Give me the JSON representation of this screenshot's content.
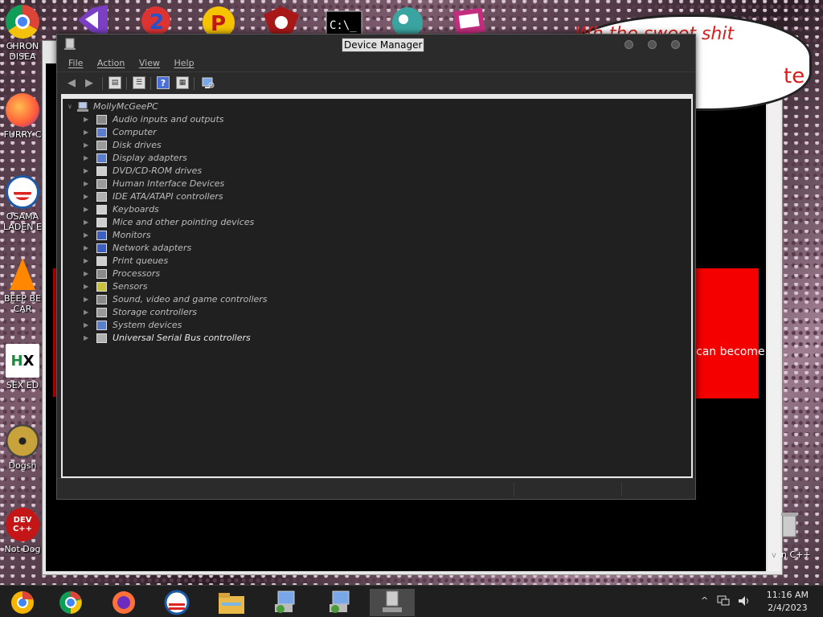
{
  "desktop": {
    "icons": [
      {
        "label_1": "CHRON",
        "label_2": "DISEA",
        "icon": "chrome-icon"
      },
      {
        "label_1": "FURRY C",
        "label_2": "",
        "icon": "firefox-icon"
      },
      {
        "label_1": "OSAMA",
        "label_2": "LADEN E",
        "icon": "obama-logo-icon"
      },
      {
        "label_1": "BEEP BE",
        "label_2": "CAR",
        "icon": "vlc-cone-icon"
      },
      {
        "label_1": "SEX ED",
        "label_2": "",
        "icon": "hx-icon"
      },
      {
        "label_1": "Dogsh",
        "label_2": "",
        "icon": "disc-icon"
      },
      {
        "label_1": "Not Dog",
        "label_2": "",
        "icon": "dev-cpp-icon",
        "glyph": "DEV C++"
      }
    ],
    "top_icons": [
      "visual-studio-icon",
      "blue-2-icon",
      "p-icon",
      "red-emblem-icon",
      "cmd-icon",
      "globe-icon",
      "media-icon"
    ],
    "right_label": "n C++"
  },
  "background_window": {
    "bubble_text": "Wh  the  sweet shit",
    "bubble_text2": "te",
    "red_panel_text": "can become"
  },
  "device_manager": {
    "title": "Device Manager",
    "menu": [
      {
        "label": "File"
      },
      {
        "label": "Action"
      },
      {
        "label": "View"
      },
      {
        "label": "Help"
      }
    ],
    "toolbar": [
      "back-arrow-icon",
      "forward-arrow-icon",
      "show-hide-console-tree-icon",
      "properties-icon",
      "help-icon",
      "view-icon",
      "scan-hardware-icon"
    ],
    "root": "MollyMcGeePC",
    "categories": [
      {
        "label": "Audio inputs and outputs",
        "icon": "speaker-icon"
      },
      {
        "label": "Computer",
        "icon": "computer-icon"
      },
      {
        "label": "Disk drives",
        "icon": "disk-drive-icon"
      },
      {
        "label": "Display adapters",
        "icon": "display-adapter-icon"
      },
      {
        "label": "DVD/CD-ROM drives",
        "icon": "dvd-drive-icon"
      },
      {
        "label": "Human Interface Devices",
        "icon": "hid-icon"
      },
      {
        "label": "IDE ATA/ATAPI controllers",
        "icon": "ide-controller-icon"
      },
      {
        "label": "Keyboards",
        "icon": "keyboard-icon"
      },
      {
        "label": "Mice and other pointing devices",
        "icon": "mouse-icon"
      },
      {
        "label": "Monitors",
        "icon": "monitor-icon"
      },
      {
        "label": "Network adapters",
        "icon": "network-adapter-icon"
      },
      {
        "label": "Print queues",
        "icon": "printer-icon"
      },
      {
        "label": "Processors",
        "icon": "processor-icon"
      },
      {
        "label": "Sensors",
        "icon": "sensor-icon"
      },
      {
        "label": "Sound, video and game controllers",
        "icon": "sound-icon"
      },
      {
        "label": "Storage controllers",
        "icon": "storage-controller-icon"
      },
      {
        "label": "System devices",
        "icon": "system-devices-icon"
      },
      {
        "label": "Universal Serial Bus controllers",
        "icon": "usb-icon"
      }
    ]
  },
  "taskbar": {
    "apps": [
      "chrome-canary-icon",
      "chrome-icon",
      "firefox-icon",
      "obama-logo-icon",
      "file-explorer-icon",
      "installer-icon",
      "installer-icon-2",
      "device-manager-icon"
    ],
    "active_index": 7,
    "time": "11:16 AM",
    "date": "2/4/2023",
    "tray_up": "^"
  },
  "colors": {
    "window_bg": "#2a2a2a",
    "tree_bg": "#202020",
    "tree_text": "#bcbcbc",
    "taskbar_bg": "#1f1f1f",
    "red_panel": "#f40000"
  }
}
